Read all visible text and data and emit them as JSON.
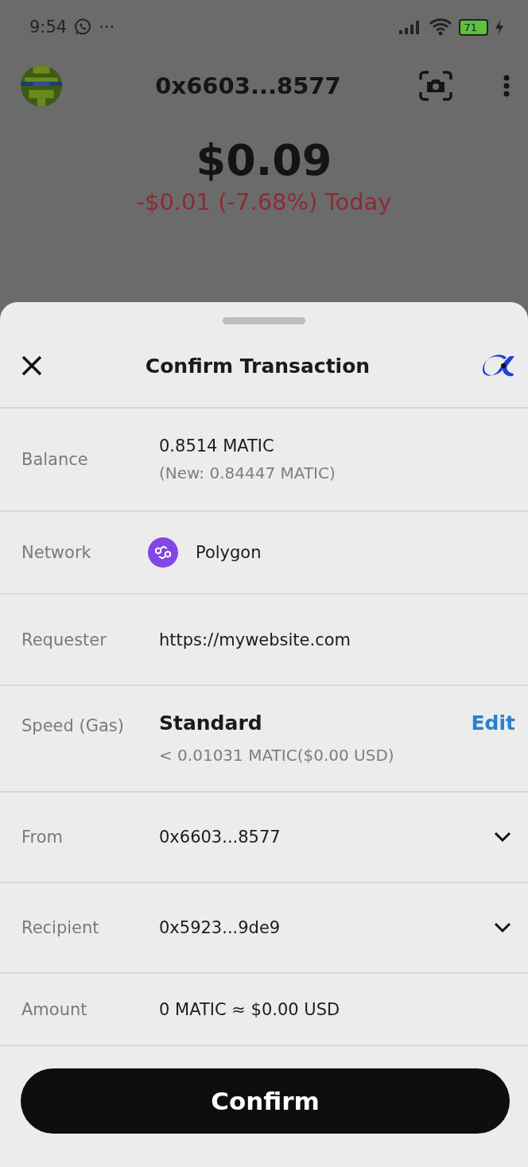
{
  "status_bar": {
    "time": "9:54",
    "more": "···",
    "battery": "71"
  },
  "wallet": {
    "address": "0x6603...8577",
    "balance": "$0.09",
    "change": "-$0.01 (-7.68%) Today"
  },
  "sheet": {
    "title": "Confirm Transaction",
    "rows": [
      {
        "kind": "value",
        "label": "Balance",
        "value": "0.8514 MATIC",
        "note": "(New: 0.84447 MATIC)"
      },
      {
        "kind": "network",
        "label": "Network",
        "value": "Polygon"
      },
      {
        "kind": "value",
        "label": "Requester",
        "value": "https://mywebsite.com"
      },
      {
        "kind": "speed",
        "label": "Speed (Gas)",
        "value": "Standard",
        "note": "< 0.01031 MATIC($0.00 USD)",
        "action": "Edit"
      },
      {
        "kind": "account",
        "label": "From",
        "value": "0x6603...8577",
        "expanded": false
      },
      {
        "kind": "account",
        "label": "Recipient",
        "value": "0x5923...9de9",
        "expanded": false
      },
      {
        "kind": "value",
        "label": "Amount",
        "value": "0 MATIC ≈ $0.00 USD"
      }
    ],
    "confirm": "Confirm"
  }
}
